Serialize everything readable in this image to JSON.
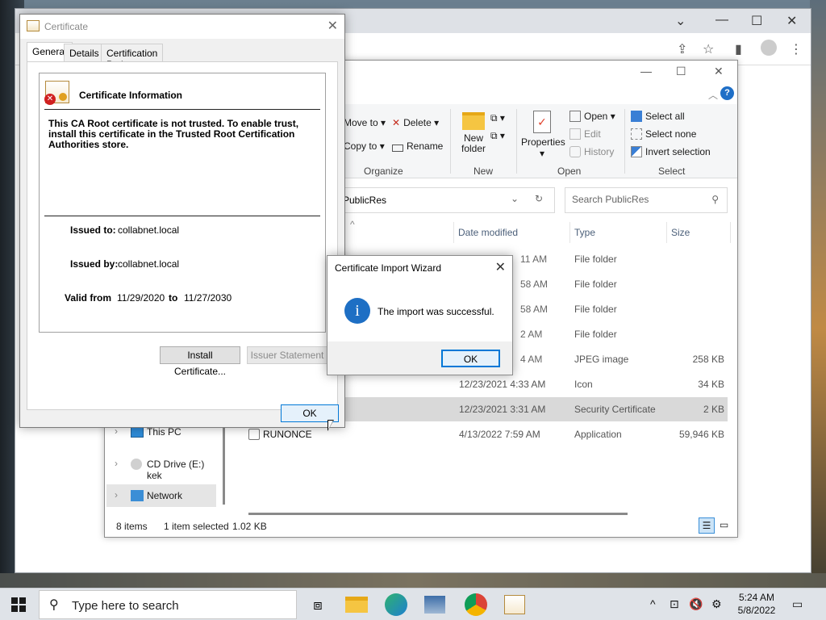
{
  "explorer": {
    "ribbon": {
      "move_to": "Move to",
      "copy_to": "Copy to",
      "delete": "Delete",
      "rename": "Rename",
      "new_folder": "New folder",
      "properties": "Properties",
      "open": "Open",
      "edit": "Edit",
      "history": "History",
      "select_all": "Select all",
      "select_none": "Select none",
      "invert_selection": "Invert selection",
      "groups": {
        "organize": "Organize",
        "new": "New",
        "open": "Open",
        "select": "Select"
      }
    },
    "address": "PublicRes",
    "search_placeholder": "Search PublicRes",
    "columns": {
      "date": "Date modified",
      "type": "Type",
      "size": "Size"
    },
    "rows": [
      {
        "name": "",
        "date": "11 AM",
        "type": "File folder",
        "size": ""
      },
      {
        "name": "",
        "date": "58 AM",
        "type": "File folder",
        "size": ""
      },
      {
        "name": "",
        "date": "58 AM",
        "type": "File folder",
        "size": ""
      },
      {
        "name": "",
        "date": "2 AM",
        "type": "File folder",
        "size": ""
      },
      {
        "name": "",
        "date": "4 AM",
        "type": "JPEG image",
        "size": "258 KB"
      },
      {
        "name": "",
        "date": "12/23/2021 4:33 AM",
        "type": "Icon",
        "size": "34 KB"
      },
      {
        "name": "",
        "date": "12/23/2021 3:31 AM",
        "type": "Security Certificate",
        "size": "2 KB"
      },
      {
        "name": "RUNONCE",
        "date": "4/13/2022 7:59 AM",
        "type": "Application",
        "size": "59,946 KB"
      }
    ],
    "nav": {
      "this_pc": "This PC",
      "cd_drive": "CD Drive (E:) kek",
      "network": "Network"
    },
    "status": {
      "items": "8 items",
      "selected": "1 item selected",
      "size": "1.02 KB"
    }
  },
  "certificate": {
    "title": "Certificate",
    "tabs": [
      "General",
      "Details",
      "Certification Path"
    ],
    "heading": "Certificate Information",
    "message": "This CA Root certificate is not trusted. To enable trust, install this certificate in the Trusted Root Certification Authorities store.",
    "issued_to_label": "Issued to:",
    "issued_to": "collabnet.local",
    "issued_by_label": "Issued by:",
    "issued_by": "collabnet.local",
    "valid_from_label": "Valid from",
    "valid_from": "11/29/2020",
    "to_label": "to",
    "valid_to": "11/27/2030",
    "install_button": "Install Certificate...",
    "issuer_button": "Issuer Statement",
    "ok_button": "OK"
  },
  "wizard": {
    "title": "Certificate Import Wizard",
    "message": "The import was successful.",
    "ok_button": "OK"
  },
  "taskbar": {
    "search_placeholder": "Type here to search",
    "time": "5:24 AM",
    "date": "5/8/2022"
  },
  "colors": {
    "accent": "#0078d7",
    "info": "#1e6fc4",
    "error": "#d02020"
  }
}
